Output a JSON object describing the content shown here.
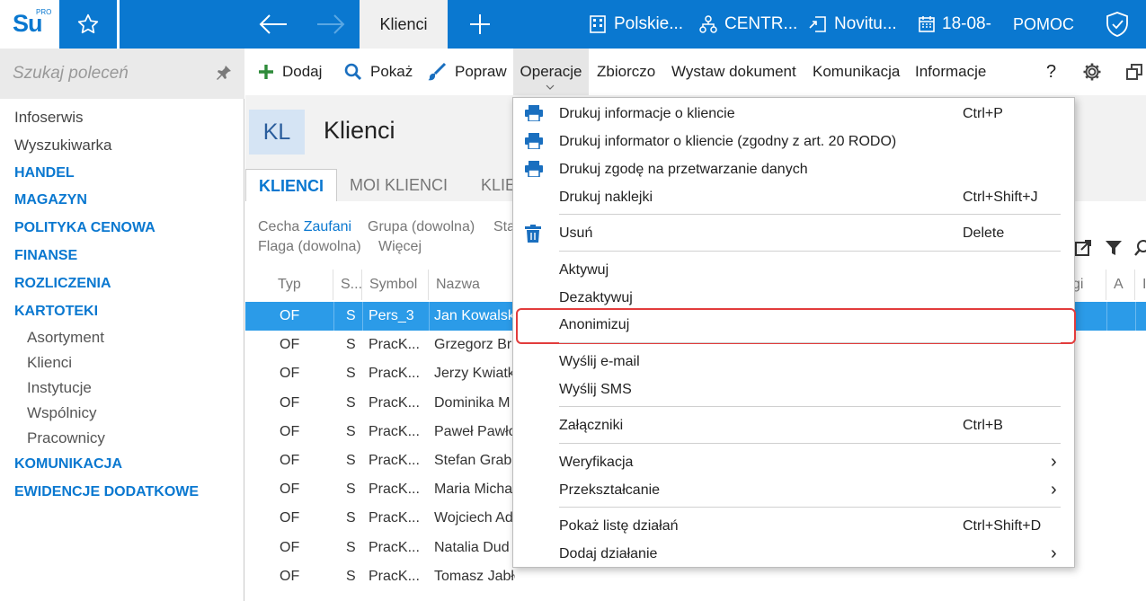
{
  "app": {
    "logo_text": "Su",
    "logo_pro": "PRO",
    "active_tab": "Klienci",
    "company": "Polskie...",
    "warehouse": "CENTR...",
    "user": "Novitu...",
    "date": "18-08-",
    "help": "POMOC"
  },
  "sidebar": {
    "search_placeholder": "Szukaj poleceń",
    "items": [
      {
        "label": "Infoserwis",
        "kind": "plain"
      },
      {
        "label": "Wyszukiwarka",
        "kind": "plain"
      },
      {
        "label": "HANDEL",
        "kind": "sec"
      },
      {
        "label": "MAGAZYN",
        "kind": "sec"
      },
      {
        "label": "POLITYKA CENOWA",
        "kind": "sec"
      },
      {
        "label": "FINANSE",
        "kind": "sec"
      },
      {
        "label": "ROZLICZENIA",
        "kind": "sec"
      },
      {
        "label": "KARTOTEKI",
        "kind": "sec"
      },
      {
        "label": "Asortyment",
        "kind": "sub"
      },
      {
        "label": "Klienci",
        "kind": "sub"
      },
      {
        "label": "Instytucje",
        "kind": "sub"
      },
      {
        "label": "Wspólnicy",
        "kind": "sub"
      },
      {
        "label": "Pracownicy",
        "kind": "sub"
      },
      {
        "label": "KOMUNIKACJA",
        "kind": "sec"
      },
      {
        "label": "EWIDENCJE DODATKOWE",
        "kind": "sec"
      }
    ]
  },
  "toolbar": {
    "add": "Dodaj",
    "show": "Pokaż",
    "edit": "Popraw",
    "operations": "Operacje",
    "collective": "Zbiorczo",
    "issue_document": "Wystaw dokument",
    "communication": "Komunikacja",
    "information": "Informacje",
    "help_q": "?"
  },
  "page": {
    "badge": "KL",
    "title": "Klienci",
    "tabs": [
      "KLIENCI",
      "MOI KLIENCI",
      "KLIE"
    ],
    "filters": {
      "feature_label": "Cecha",
      "feature_value": "Zaufani",
      "group": "Grupa (dowolna)",
      "status": "Sta",
      "flag": "Flaga (dowolna)",
      "more": "Więcej"
    },
    "columns": [
      "Typ",
      "S...",
      "Symbol",
      "Nazwa",
      "gi",
      "A",
      "I"
    ],
    "rows": [
      {
        "typ": "OF",
        "s": "S",
        "symbol": "Pers_3",
        "name": "Jan Kowalski",
        "selected": true
      },
      {
        "typ": "OF",
        "s": "S",
        "symbol": "PracK...",
        "name": "Grzegorz Br"
      },
      {
        "typ": "OF",
        "s": "S",
        "symbol": "PracK...",
        "name": "Jerzy Kwiatk"
      },
      {
        "typ": "OF",
        "s": "S",
        "symbol": "PracK...",
        "name": "Dominika M"
      },
      {
        "typ": "OF",
        "s": "S",
        "symbol": "PracK...",
        "name": "Paweł Pawło"
      },
      {
        "typ": "OF",
        "s": "S",
        "symbol": "PracK...",
        "name": "Stefan Grab"
      },
      {
        "typ": "OF",
        "s": "S",
        "symbol": "PracK...",
        "name": "Maria Micha"
      },
      {
        "typ": "OF",
        "s": "S",
        "symbol": "PracK...",
        "name": "Wojciech Ad"
      },
      {
        "typ": "OF",
        "s": "S",
        "symbol": "PracK...",
        "name": "Natalia Dud"
      },
      {
        "typ": "OF",
        "s": "S",
        "symbol": "PracK...",
        "name": "Tomasz Jabłoński"
      }
    ]
  },
  "menu": {
    "items": [
      {
        "label": "Drukuj informacje o kliencie",
        "shortcut": "Ctrl+P",
        "icon": "printer-icon"
      },
      {
        "label": "Drukuj informator o kliencie (zgodny z art. 20 RODO)",
        "shortcut": "",
        "icon": "printer-icon"
      },
      {
        "label": "Drukuj zgodę na przetwarzanie danych",
        "shortcut": "",
        "icon": "printer-icon"
      },
      {
        "label": "Drukuj naklejki",
        "shortcut": "Ctrl+Shift+J",
        "icon": ""
      },
      {
        "label": "Usuń",
        "shortcut": "Delete",
        "icon": "trash-icon"
      },
      {
        "label": "Aktywuj",
        "shortcut": "",
        "icon": ""
      },
      {
        "label": "Dezaktywuj",
        "shortcut": "",
        "icon": ""
      },
      {
        "label": "Anonimizuj",
        "shortcut": "",
        "icon": "",
        "highlighted": true
      },
      {
        "label": "Wyślij e-mail",
        "shortcut": "",
        "icon": ""
      },
      {
        "label": "Wyślij SMS",
        "shortcut": "",
        "icon": ""
      },
      {
        "label": "Załączniki",
        "shortcut": "Ctrl+B",
        "icon": ""
      },
      {
        "label": "Weryfikacja",
        "shortcut": "",
        "icon": "",
        "submenu": true
      },
      {
        "label": "Przekształcanie",
        "shortcut": "",
        "icon": "",
        "submenu": true
      },
      {
        "label": "Pokaż listę działań",
        "shortcut": "Ctrl+Shift+D",
        "icon": ""
      },
      {
        "label": "Dodaj działanie",
        "shortcut": "",
        "icon": "",
        "submenu": true
      }
    ],
    "submenu_arrow": "›"
  },
  "colors": {
    "brand_blue": "#0a78d0",
    "selected_row": "#2b9be8",
    "highlight_border": "#e23c3c",
    "add_green": "#2e8b3a"
  }
}
